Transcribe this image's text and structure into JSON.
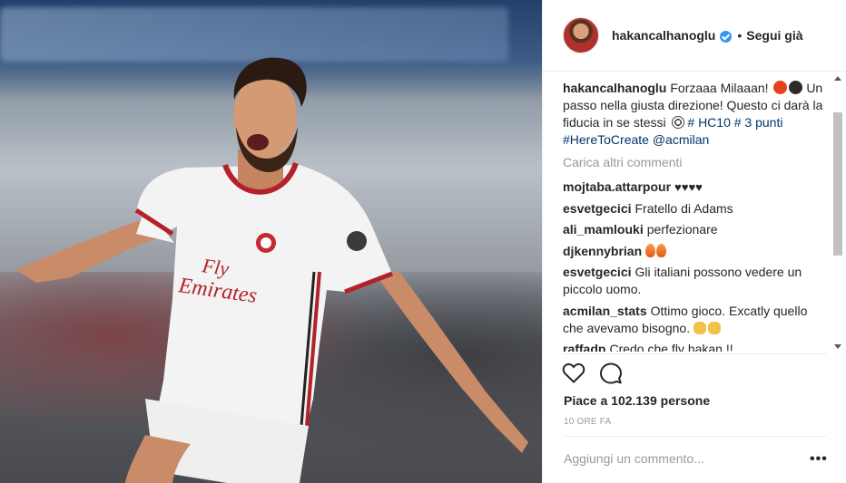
{
  "header": {
    "username": "hakancalhanoglu",
    "separator": "•",
    "follow_label": "Segui già"
  },
  "caption": {
    "username": "hakancalhanoglu",
    "text_1": "Forzaaa Milaaan!",
    "text_2": "Un passo nella giusta direzione! Questo ci darà la fiducia in se stessi",
    "hashtags": "# HC10 # 3 punti #HereToCreate @acmilan"
  },
  "load_more_label": "Carica altri commenti",
  "comments": [
    {
      "user": "mojtaba.attarpour",
      "text": "♥♥♥♥"
    },
    {
      "user": "esvetgecici",
      "text": "Fratello di Adams"
    },
    {
      "user": "ali_mamlouki",
      "text": "perfezionare"
    },
    {
      "user": "djkennybrian",
      "text": ""
    },
    {
      "user": "esvetgecici",
      "text": "Gli italiani possono vedere un piccolo uomo."
    },
    {
      "user": "acmilan_stats",
      "text": "Ottimo gioco. Excatly quello che avevamo bisogno."
    },
    {
      "user": "raffadp",
      "text": "Credo che fly hakan !!"
    }
  ],
  "likes_text": "Piace a 102.139 persone",
  "time_text": "10 ORE FA",
  "add_comment_placeholder": "Aggiungi un commento...",
  "more_options": "•••",
  "photo": {
    "jersey_sponsor": "Fly Emirates"
  },
  "colors": {
    "link": "#003569",
    "verified": "#3897f0",
    "muted": "#999999"
  },
  "icons": [
    "verified-badge-icon",
    "heart-icon",
    "comment-icon",
    "more-options-icon"
  ]
}
